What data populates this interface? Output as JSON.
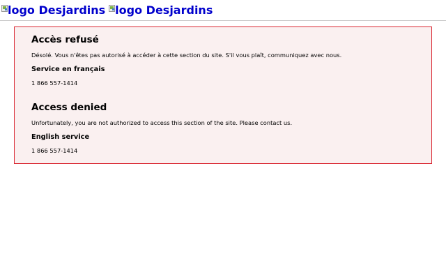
{
  "header": {
    "logos": [
      {
        "alt_text": "logo Desjardins",
        "icon": "broken-image-icon"
      },
      {
        "alt_text": "logo Desjardins",
        "icon": "broken-image-icon"
      }
    ]
  },
  "alert": {
    "border_color": "#d9232e",
    "background_color": "#faf0f0",
    "french": {
      "title": "Accès refusé",
      "message": "Désolé. Vous n'êtes pas autorisé à accéder à cette section du site. S'il vous plaît, communiquez avec nous.",
      "service_label": "Service en français",
      "phone": "1 866 557-1414"
    },
    "english": {
      "title": "Access denied",
      "message": "Unfortunately, you are not authorized to access this section of the site. Please contact us.",
      "service_label": "English service",
      "phone": "1 866 557-1414"
    }
  }
}
